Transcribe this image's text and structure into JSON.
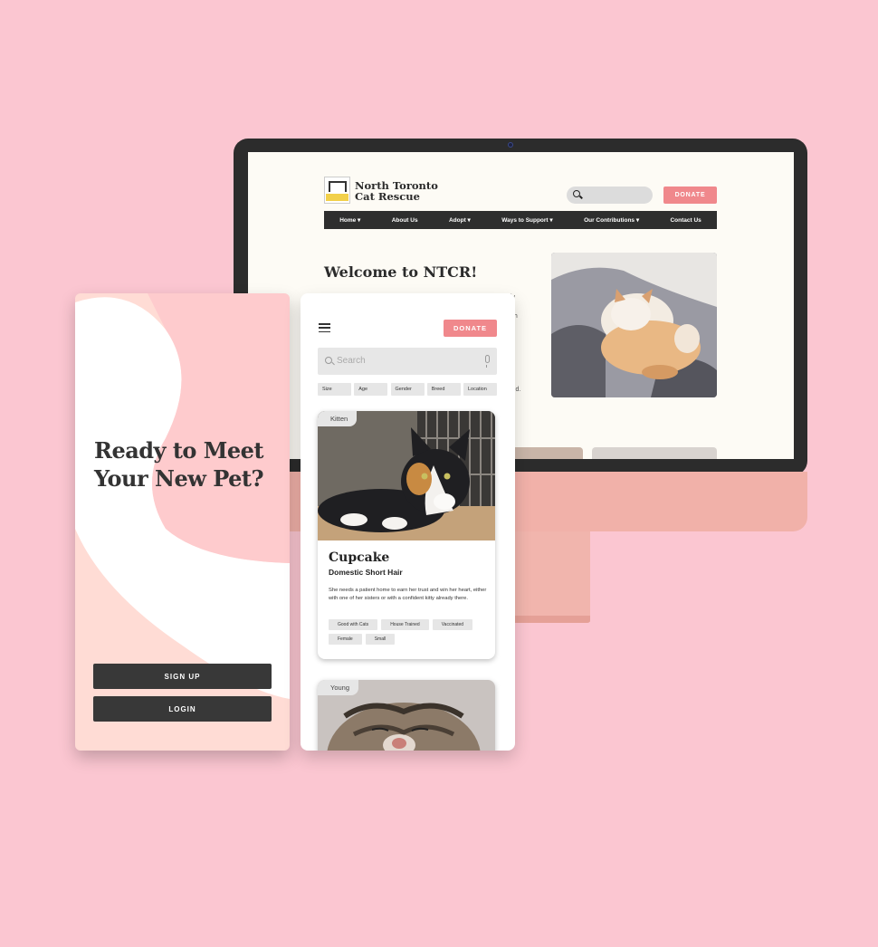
{
  "desktop_site": {
    "brand_line1": "North Toronto",
    "brand_line2": "Cat Rescue",
    "logo_text": "NORTH TORONTO CAT RESCUE",
    "donate_label": "DONATE",
    "nav": [
      {
        "label": "Home",
        "has_dropdown": true
      },
      {
        "label": "About Us",
        "has_dropdown": false
      },
      {
        "label": "Adopt",
        "has_dropdown": true
      },
      {
        "label": "Ways to Support",
        "has_dropdown": true
      },
      {
        "label": "Our Contributions",
        "has_dropdown": true
      },
      {
        "label": "Contact Us",
        "has_dropdown": false
      }
    ],
    "welcome_heading": "Welcome to NTCR!",
    "body_fragments": [
      "ly",
      "gh",
      "a",
      "g",
      "led."
    ],
    "accent_color": "#f0888c",
    "nav_color": "#2e2e2e"
  },
  "phone_welcome": {
    "title_line1": "Ready to Meet",
    "title_line2": "Your New Pet?",
    "signup_label": "SIGN UP",
    "login_label": "LOGIN"
  },
  "phone_listing": {
    "donate_label": "DONATE",
    "search_placeholder": "Search",
    "filters": [
      "Size",
      "Age",
      "Gender",
      "Breed",
      "Location"
    ],
    "cards": [
      {
        "tag": "Kitten",
        "name": "Cupcake",
        "breed": "Domestic Short Hair",
        "description": "She needs a patient home to earn her trust and win her heart, either with one of her sisters or with a confident kitty already there.",
        "chips": [
          "Good with Cats",
          "House Trained",
          "Vaccinated",
          "Female",
          "Small"
        ]
      },
      {
        "tag": "Young"
      }
    ]
  },
  "colors": {
    "background": "#fbc6d1",
    "phone_pink": "#ffdcd5",
    "button_dark": "#383838"
  }
}
